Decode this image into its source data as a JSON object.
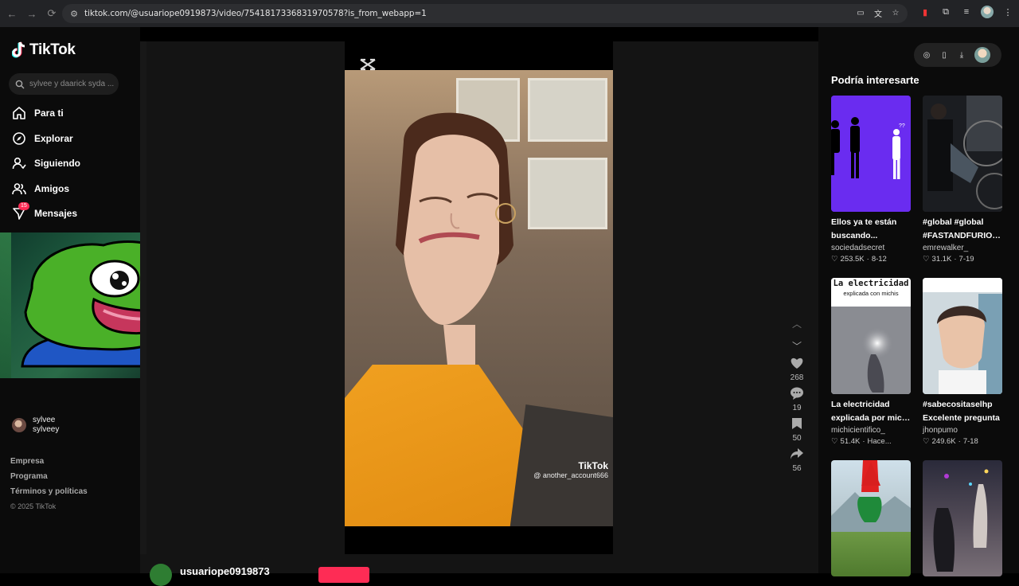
{
  "browser": {
    "url": "tiktok.com/@usuariope0919873/video/7541817336831970578?is_from_webapp=1"
  },
  "sidebar": {
    "logo_text": "TikTok",
    "search_placeholder": "sylvee y daarick syda ...",
    "items": [
      {
        "label": "Para ti",
        "icon": "home-icon"
      },
      {
        "label": "Explorar",
        "icon": "compass-icon"
      },
      {
        "label": "Siguiendo",
        "icon": "following-icon"
      },
      {
        "label": "Amigos",
        "icon": "friends-icon"
      },
      {
        "label": "Mensajes",
        "icon": "messages-icon",
        "badge": "15"
      }
    ],
    "account": {
      "name": "sylvee",
      "handle": "sylveey"
    },
    "footer": [
      "Empresa",
      "Programa",
      "Términos y políticas"
    ],
    "copyright": "© 2025 TikTok"
  },
  "video": {
    "watermark_brand": "TikTok",
    "watermark_user": "@ another_account666",
    "author": "usuariope0919873"
  },
  "actions": {
    "likes": "268",
    "comments": "19",
    "saves": "50",
    "shares": "56"
  },
  "right": {
    "title": "Podría interesarte",
    "cards": [
      {
        "title1": "Ellos ya te están",
        "title2": "buscando...",
        "user": "sociedadsecret",
        "likes": "253.5K",
        "date": "8-12"
      },
      {
        "title1": "#global #global",
        "title2": "#FASTANDFURIOU...",
        "user": "emrewalker_",
        "likes": "31.1K",
        "date": "7-19"
      },
      {
        "title1": "La electricidad",
        "title2": "explicada por michis",
        "user": "michicientifico_",
        "likes": "51.4K",
        "date": "Hace..."
      },
      {
        "title1": "#sabecositaselhp",
        "title2": "Excelente pregunta",
        "user": "jhonpumo",
        "likes": "249.6K",
        "date": "7-18"
      }
    ],
    "thumb3_caption1": "La electricidad",
    "thumb3_caption2": "explicada con michis"
  },
  "colors": {
    "accent": "#fe2c55",
    "purple_card": "#6a2cf0"
  }
}
